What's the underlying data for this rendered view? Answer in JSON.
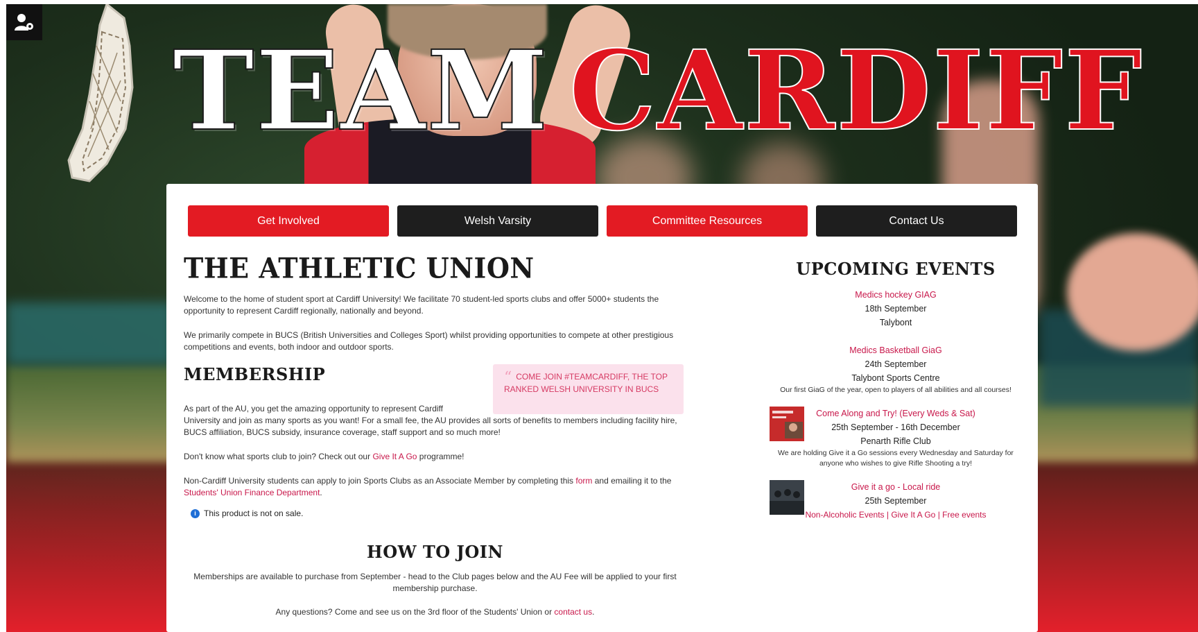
{
  "hero": {
    "title_part1": "TEAM",
    "title_part2": "CARDIFF"
  },
  "nav": {
    "items": [
      {
        "label": "Get Involved",
        "style": "red"
      },
      {
        "label": "Welsh Varsity",
        "style": "dark"
      },
      {
        "label": "Committee Resources",
        "style": "red"
      },
      {
        "label": "Contact Us",
        "style": "dark"
      }
    ]
  },
  "athletic_union": {
    "heading": "THE ATHLETIC UNION",
    "para1": "Welcome to the home of student sport at Cardiff University! We facilitate 70 student-led sports clubs and offer 5000+ students the opportunity to represent Cardiff regionally, nationally and beyond.",
    "para2": "We primarily compete in BUCS (British Universities and Colleges Sport) whilst providing opportunities to compete at other prestigious competitions and events, both indoor and outdoor sports."
  },
  "membership": {
    "heading": "MEMBERSHIP",
    "quote": "COME JOIN #TEAMCARDIFF, THE TOP RANKED WELSH UNIVERSITY IN BUCS",
    "para1_a": "As part of the AU, you get the amazing opportunity to represent Cardiff",
    "para1_b": "University and join as many sports as you want! For a small fee, the AU provides all sorts of benefits to members including facility hire, BUCS affiliation, BUCS subsidy, insurance coverage, staff support and so much more!",
    "para2_before": "Don't know what sports club to join? Check out our ",
    "para2_link": "Give It A Go",
    "para2_after": " programme!",
    "para3_before": "Non-Cardiff University students can apply to join Sports Clubs as an Associate Member by completing this ",
    "para3_link1": "form",
    "para3_mid": " and emailing it to the ",
    "para3_link2": "Students' Union Finance Department",
    "para3_after": ".",
    "notice": "This product is not on sale."
  },
  "how_to_join": {
    "heading": "HOW TO JOIN",
    "para1": "Memberships are available to purchase from September - head to the Club pages below and the AU Fee will be applied to your first membership purchase.",
    "para2_before": "Any questions? Come and see us on the 3rd floor of the Students' Union or ",
    "para2_link": "contact us",
    "para2_after": "."
  },
  "events": {
    "heading": "UPCOMING EVENTS",
    "items": [
      {
        "name": "Medics hockey GIAG",
        "date": "18th September",
        "venue": "Talybont"
      },
      {
        "name": "Medics Basketball GiaG",
        "date": "24th September",
        "venue": "Talybont Sports Centre",
        "desc": "Our first GiaG of the year, open to players of all abilities and all courses!"
      },
      {
        "name": "Come Along and Try! (Every Weds & Sat)",
        "date": "25th September - 16th December",
        "venue": "Penarth Rifle Club",
        "desc": "We are holding Give it a Go sessions every Wednesday and Saturday for anyone who wishes to give Rifle Shooting a try!"
      },
      {
        "name": "Give it a go - Local ride",
        "date": "25th September",
        "tags": [
          "Non-Alcoholic Events",
          "Give It A Go",
          "Free events"
        ]
      }
    ]
  },
  "colors": {
    "brand_red": "#e31b23",
    "dark": "#1e1e1e",
    "link": "#c8174a",
    "quote_bg": "#fbe1ec"
  },
  "icons": {
    "admin": "user-gear-icon",
    "info": "info-icon",
    "quote": "quote-mark-icon"
  }
}
